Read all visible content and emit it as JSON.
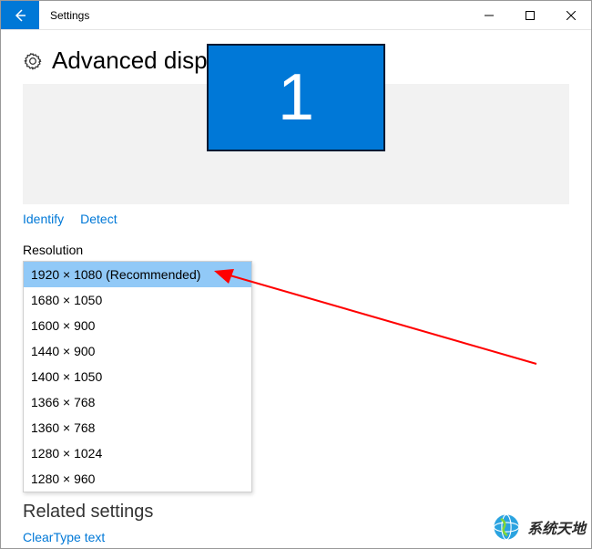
{
  "titlebar": {
    "title": "Settings"
  },
  "page": {
    "heading": "Advanced display settings",
    "monitor_label": "1"
  },
  "actions": {
    "identify": "Identify",
    "detect": "Detect"
  },
  "resolution": {
    "label": "Resolution",
    "options": [
      "1920 × 1080 (Recommended)",
      "1680 × 1050",
      "1600 × 900",
      "1440 × 900",
      "1400 × 1050",
      "1366 × 768",
      "1360 × 768",
      "1280 × 1024",
      "1280 × 960"
    ],
    "selected_index": 0
  },
  "related": {
    "heading": "Related settings",
    "link": "ClearType text"
  },
  "watermark": {
    "text": "系统天地"
  }
}
